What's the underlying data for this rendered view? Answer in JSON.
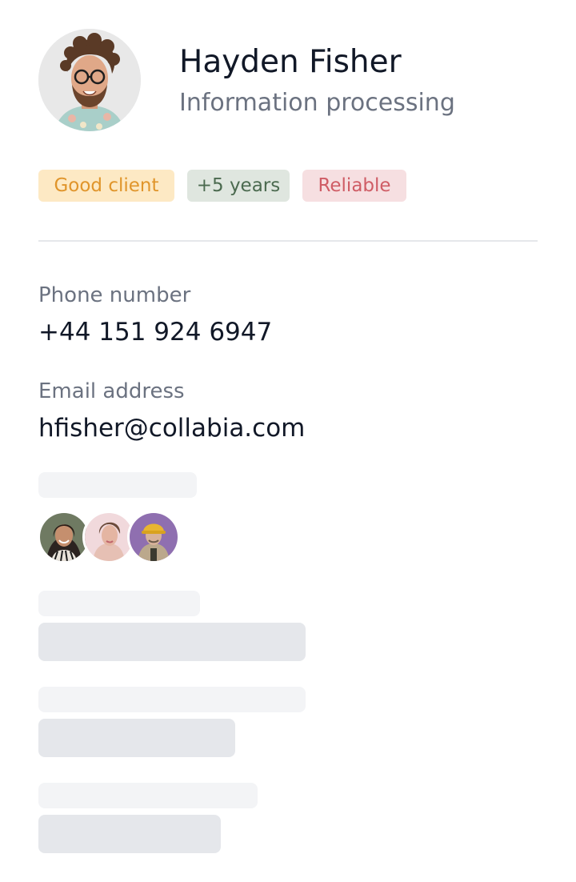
{
  "profile": {
    "name": "Hayden Fisher",
    "role": "Information processing"
  },
  "tags": [
    {
      "label": "Good client",
      "bg": "#fde9c4",
      "color": "#e0952b"
    },
    {
      "label": "+5 years",
      "bg": "#dfe6df",
      "color": "#4b6a4f"
    },
    {
      "label": "Reliable",
      "bg": "#f6dfe1",
      "color": "#cf5c65"
    }
  ],
  "fields": {
    "phone": {
      "label": "Phone number",
      "value": "+44 151 924 6947"
    },
    "email": {
      "label": "Email address",
      "value": "hfisher@collabia.com"
    }
  },
  "colors": {
    "text_primary": "#111827",
    "text_secondary": "#6b7280",
    "skeleton_light": "#f3f4f6",
    "skeleton_dark": "#e5e7eb"
  }
}
